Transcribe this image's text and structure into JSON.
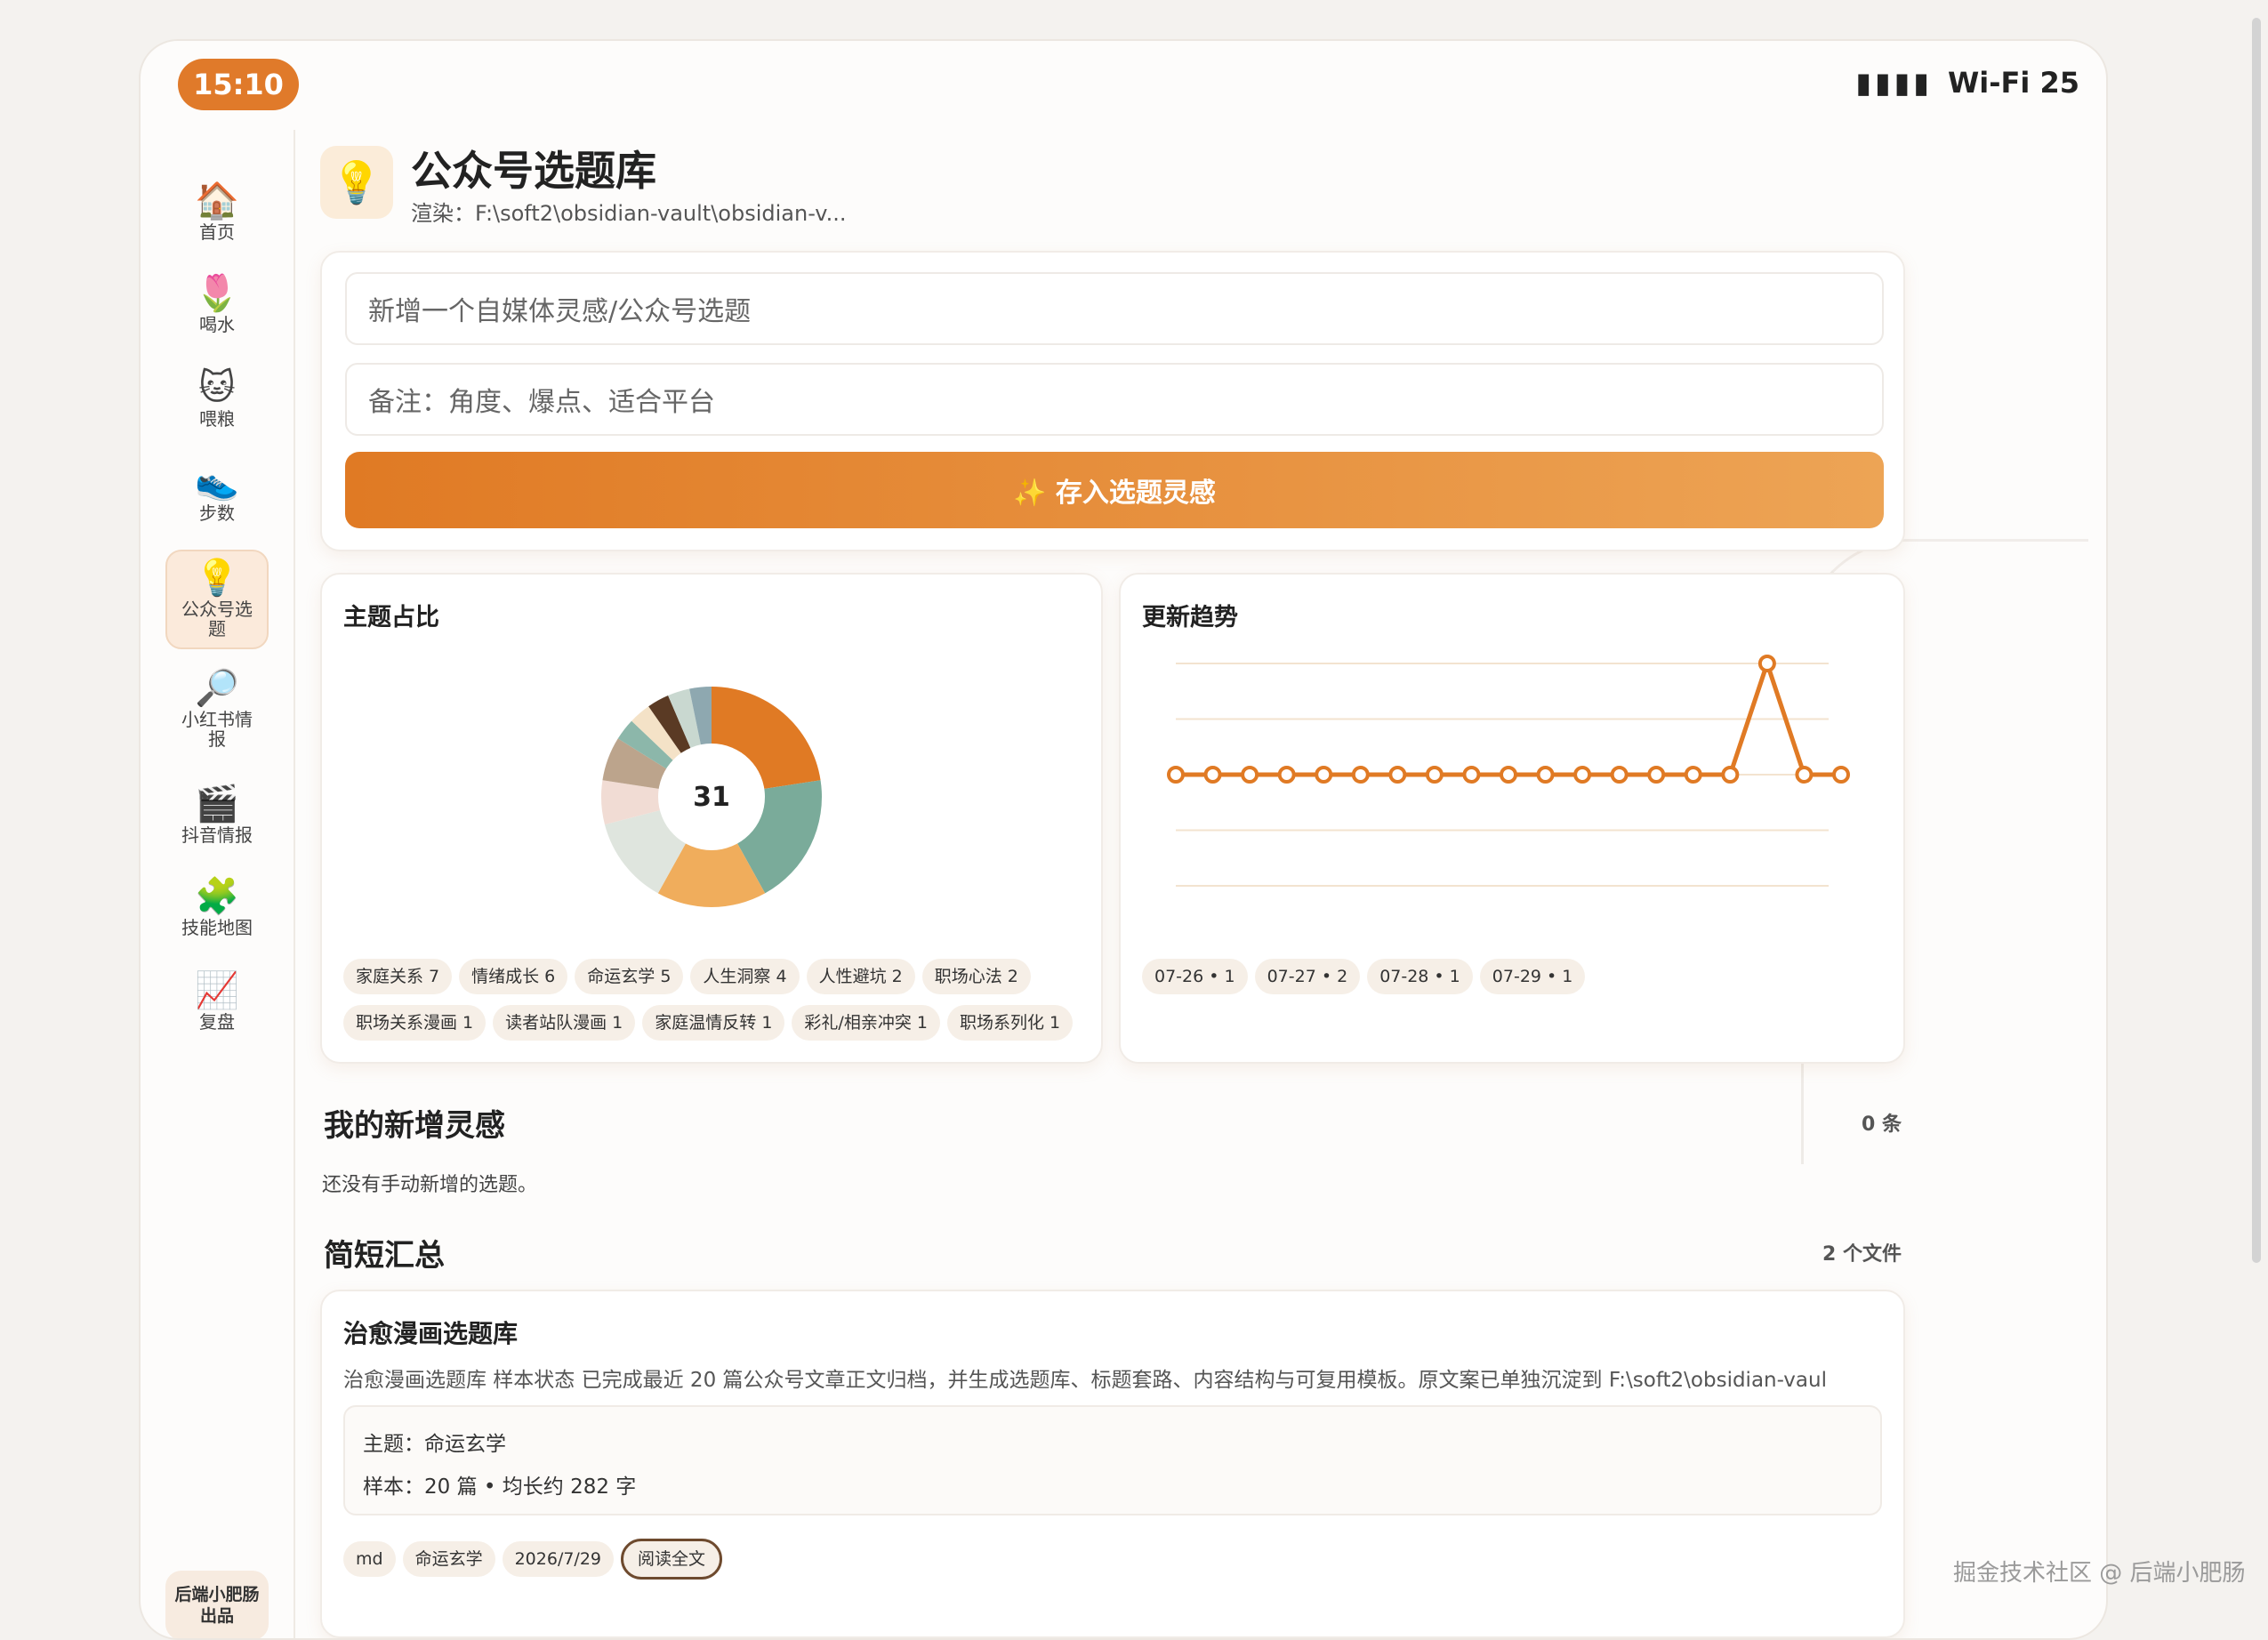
{
  "status": {
    "time": "15:10",
    "signal": "▮▮▮▮",
    "wifi": "Wi-Fi 25"
  },
  "sidebar": {
    "items": [
      {
        "icon": "house-icon",
        "glyph": "🏠",
        "label": "首页"
      },
      {
        "icon": "tulip-icon",
        "glyph": "🌷",
        "label": "喝水"
      },
      {
        "icon": "cat-icon",
        "glyph": "🐱",
        "label": "喂粮"
      },
      {
        "icon": "sneaker-icon",
        "glyph": "👟",
        "label": "步数"
      },
      {
        "icon": "lightbulb-icon",
        "glyph": "💡",
        "label": "公众号选题"
      },
      {
        "icon": "magnifier-icon",
        "glyph": "🔎",
        "label": "小红书情报"
      },
      {
        "icon": "clapper-icon",
        "glyph": "🎬",
        "label": "抖音情报"
      },
      {
        "icon": "puzzle-icon",
        "glyph": "🧩",
        "label": "技能地图"
      },
      {
        "icon": "chart-icon",
        "glyph": "📈",
        "label": "复盘"
      }
    ],
    "footer": "后端小肥肠出品"
  },
  "header": {
    "icon": "lightbulb-icon",
    "title": "公众号选题库",
    "subtitle": "渲染：F:\\soft2\\obsidian-vault\\obsidian-v..."
  },
  "form": {
    "title_placeholder": "新增一个自媒体灵感/公众号选题",
    "note_placeholder": "备注：角度、爆点、适合平台",
    "submit_label": "✨ 存入选题灵感"
  },
  "topic_chart": {
    "title": "主题占比",
    "center_label": "31",
    "tags": [
      "家庭关系 7",
      "情绪成长 6",
      "命运玄学 5",
      "人生洞察 4",
      "人性避坑 2",
      "职场心法 2",
      "职场关系漫画 1",
      "读者站队漫画 1",
      "家庭温情反转 1",
      "彩礼/相亲冲突 1",
      "职场系列化 1"
    ]
  },
  "trend_chart": {
    "title": "更新趋势",
    "tags": [
      "07-26 • 1",
      "07-27 • 2",
      "07-28 • 1",
      "07-29 • 1"
    ]
  },
  "chart_data": [
    {
      "type": "pie",
      "title": "主题占比",
      "center": "31",
      "slices": [
        {
          "label": "家庭关系",
          "value": 7,
          "color": "#e07a24"
        },
        {
          "label": "情绪成长",
          "value": 6,
          "color": "#7aab9a"
        },
        {
          "label": "命运玄学",
          "value": 5,
          "color": "#f0ad5c"
        },
        {
          "label": "人生洞察",
          "value": 4,
          "color": "#dfe5de"
        },
        {
          "label": "人性避坑",
          "value": 2,
          "color": "#f1dcd4"
        },
        {
          "label": "职场心法",
          "value": 2,
          "color": "#bca48c"
        },
        {
          "label": "职场关系漫画",
          "value": 1,
          "color": "#8cb7aa"
        },
        {
          "label": "读者站队漫画",
          "value": 1,
          "color": "#f4e2c7"
        },
        {
          "label": "家庭温情反转",
          "value": 1,
          "color": "#5a3a24"
        },
        {
          "label": "彩礼/相亲冲突",
          "value": 1,
          "color": "#c9d8d0"
        },
        {
          "label": "职场系列化",
          "value": 1,
          "color": "#8ea8b0"
        }
      ]
    },
    {
      "type": "line",
      "title": "更新趋势",
      "values": [
        0,
        0,
        0,
        0,
        0,
        0,
        0,
        0,
        0,
        0,
        0,
        0,
        0,
        0,
        0,
        0,
        2,
        0,
        0
      ],
      "ylim": [
        -2,
        2
      ],
      "grid": true,
      "color": "#e07a24"
    }
  ],
  "my_ideas": {
    "title": "我的新增灵感",
    "count": "0 条",
    "empty": "还没有手动新增的选题。"
  },
  "summary": {
    "title": "简短汇总",
    "count": "2 个文件",
    "card": {
      "title": "治愈漫画选题库",
      "desc": "治愈漫画选题库 样本状态 已完成最近 20 篇公众号文章正文归档，并生成选题库、标题套路、内容结构与可复用模板。原文案已单独沉淀到 F:\\soft2\\obsidian-vaul",
      "theme": "主题：命运玄学",
      "sample": "样本：20 篇 • 均长约 282 字",
      "tags": [
        "md",
        "命运玄学",
        "2026/7/29"
      ],
      "read_all": "阅读全文"
    }
  },
  "watermark": "掘金技术社区 @ 后端小肥肠"
}
